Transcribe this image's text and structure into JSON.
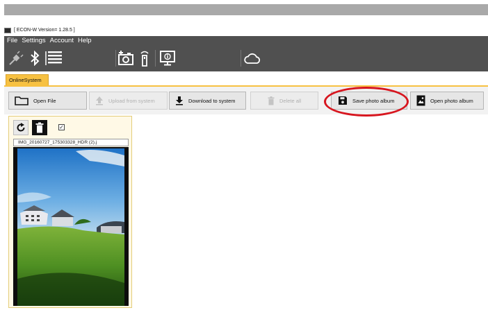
{
  "window": {
    "title": "[ ECON-W Version= 1.28.5 ]"
  },
  "menu": {
    "items": [
      "File",
      "Settings",
      "Account",
      "Help"
    ]
  },
  "toolbar_icons": [
    "disconnected-plug-icon",
    "bluetooth-icon",
    "list-icon",
    "add-camera-icon",
    "remote-icon",
    "monitor-info-icon",
    "cloud-icon"
  ],
  "tabs": {
    "active": "OnlineSystem"
  },
  "actions": {
    "open_file": "Open File",
    "upload": "Upload from system",
    "download": "Download to system",
    "delete_all": "Delete all",
    "save_album": "Save photo album",
    "open_album": "Open photo album"
  },
  "photo_card": {
    "filename": "IMG_20160727_175303328_HDR (2).j",
    "checked": "✓"
  },
  "colors": {
    "accent_tab": "#f7c141",
    "dark_bar": "#505050",
    "highlight": "#d7161f"
  }
}
